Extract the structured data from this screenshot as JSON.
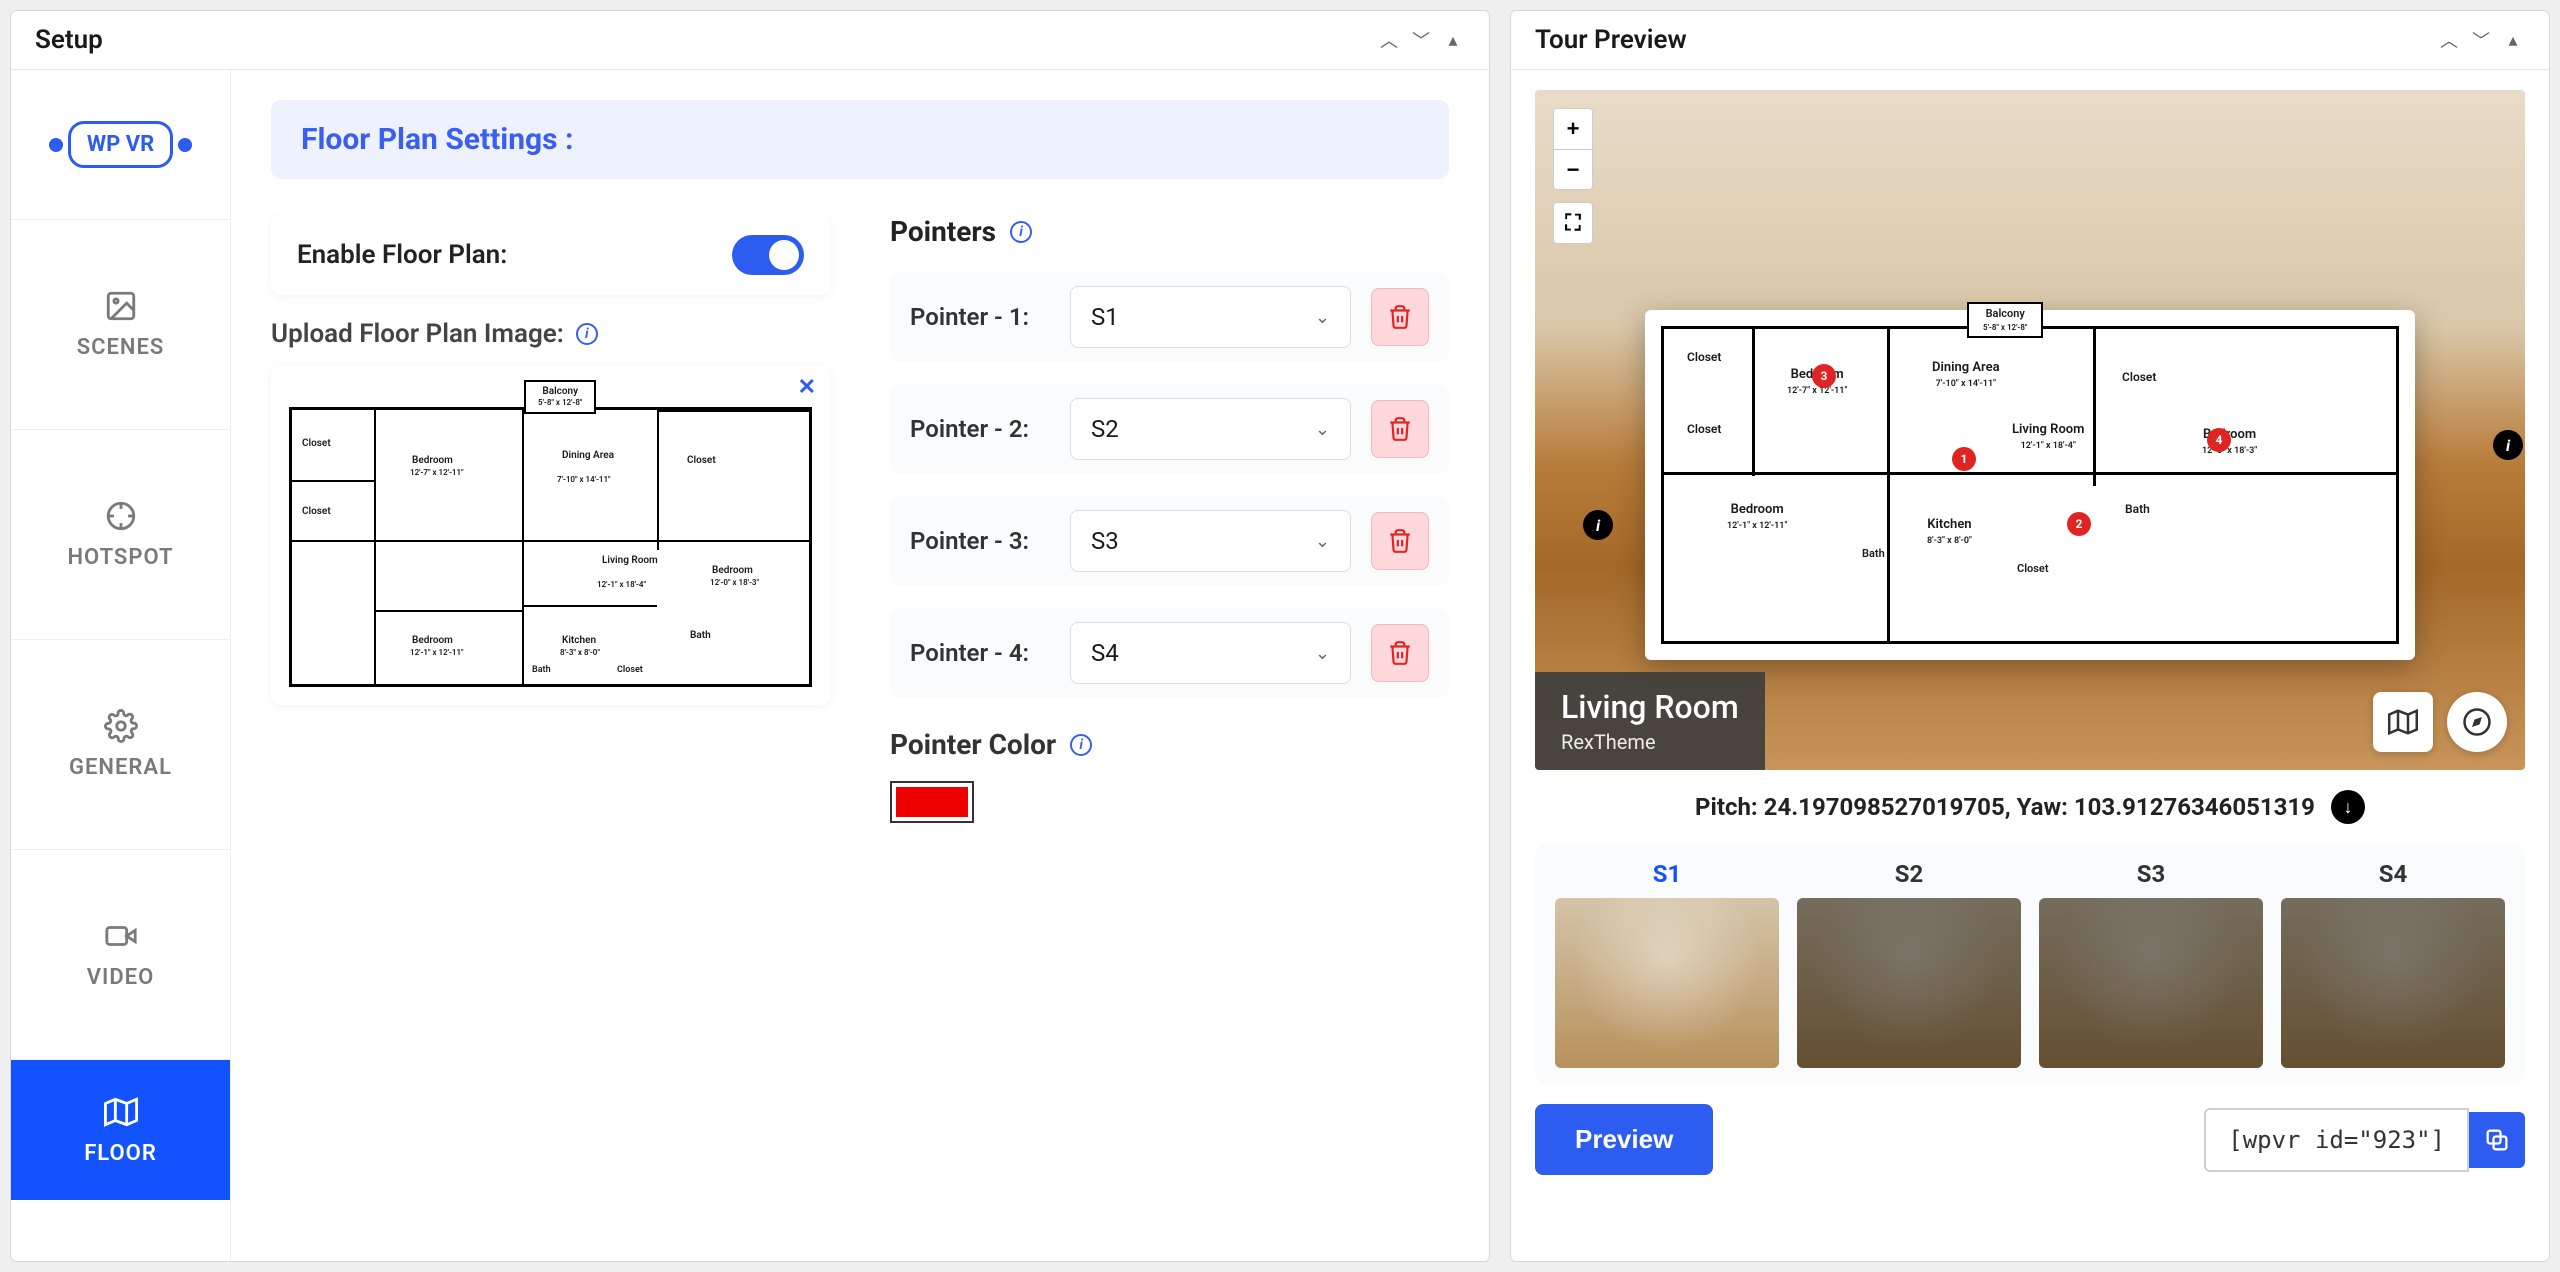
{
  "setup": {
    "title": "Setup",
    "logo": "WP VR",
    "tabs": {
      "scenes": "SCENES",
      "hotspot": "HOTSPOT",
      "general": "GENERAL",
      "video": "VIDEO",
      "floor": "FLOOR"
    },
    "floor": {
      "heading": "Floor Plan Settings :",
      "enable_label": "Enable Floor Plan:",
      "enabled": true,
      "upload_label": "Upload Floor Plan Image:",
      "pointers_label": "Pointers",
      "pointers": [
        {
          "label": "Pointer - 1:",
          "value": "S1"
        },
        {
          "label": "Pointer - 2:",
          "value": "S2"
        },
        {
          "label": "Pointer - 3:",
          "value": "S3"
        },
        {
          "label": "Pointer - 4:",
          "value": "S4"
        }
      ],
      "pointer_color_label": "Pointer Color",
      "pointer_color": "#ef0000",
      "floorplan_rooms": {
        "balcony": "Balcony",
        "balcony_dim": "5'-8\" x 12'-8\"",
        "closet": "Closet",
        "bedroom1": "Bedroom",
        "bedroom1_dim": "12'-7\" x 12'-11\"",
        "dining": "Dining Area",
        "dining_dim": "7'-10\" x 14'-11\"",
        "living": "Living Room",
        "living_dim": "12'-1\" x 18'-4\"",
        "bedroom2": "Bedroom",
        "bedroom2_dim": "12'-0\" x 18'-3\"",
        "bedroom3": "Bedroom",
        "bedroom3_dim": "12'-1\" x 12'-11\"",
        "kitchen": "Kitchen",
        "kitchen_dim": "8'-3\" x 8'-0\"",
        "bath": "Bath"
      }
    }
  },
  "preview": {
    "title": "Tour Preview",
    "scene_name": "Living Room",
    "scene_author": "RexTheme",
    "pitch": "24.197098527019705",
    "yaw": "103.91276346051319",
    "pitch_label": "Pitch:",
    "yaw_label": "Yaw:",
    "scenes": [
      {
        "id": "S1",
        "active": true
      },
      {
        "id": "S2",
        "active": false
      },
      {
        "id": "S3",
        "active": false
      },
      {
        "id": "S4",
        "active": false
      }
    ],
    "preview_btn": "Preview",
    "shortcode": "[wpvr id=\"923\"]",
    "pointer_dots": [
      "3",
      "1",
      "2",
      "4"
    ]
  }
}
